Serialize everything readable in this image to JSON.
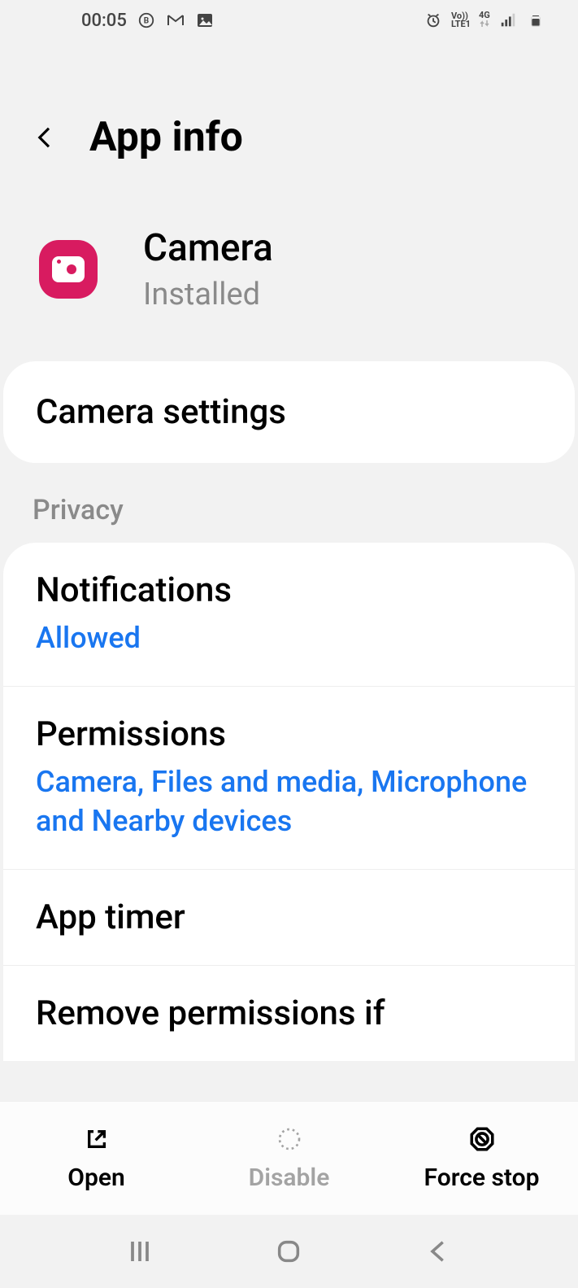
{
  "statusbar": {
    "time": "00:05",
    "lte_top": "Vo))",
    "lte_bottom": "LTE1",
    "network": "4G"
  },
  "header": {
    "title": "App info"
  },
  "app": {
    "name": "Camera",
    "status": "Installed"
  },
  "settings_row": {
    "label": "Camera settings"
  },
  "section_privacy": "Privacy",
  "rows": {
    "notifications": {
      "title": "Notifications",
      "sub": "Allowed"
    },
    "permissions": {
      "title": "Permissions",
      "sub": "Camera, Files and media, Microphone and Nearby devices"
    },
    "app_timer": {
      "title": "App timer"
    },
    "remove": {
      "title": "Remove permissions if"
    }
  },
  "bottom": {
    "open": "Open",
    "disable": "Disable",
    "force_stop": "Force stop"
  }
}
